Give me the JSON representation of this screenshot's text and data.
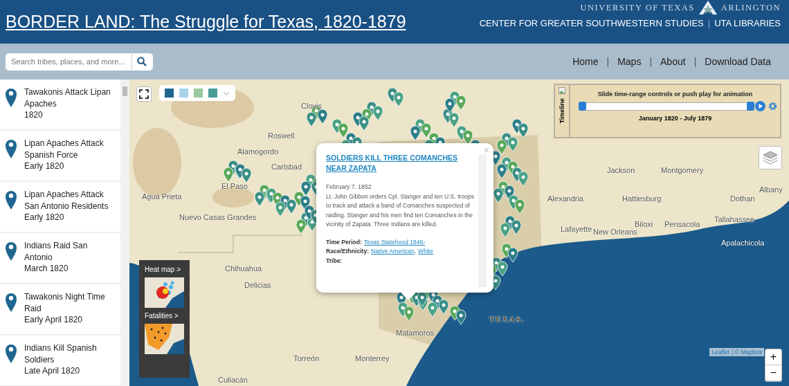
{
  "header": {
    "title": "BORDER LAND: The Struggle for Texas, 1820-1879",
    "university": "UNIVERSITY OF TEXAS",
    "university_2": "ARLINGTON",
    "links": [
      "CENTER FOR GREATER SOUTHWESTERN STUDIES",
      "UTA LIBRARIES"
    ],
    "separator": "|"
  },
  "search": {
    "placeholder": "Search tribes, places, and more..."
  },
  "nav": {
    "links": [
      "Home",
      "Maps",
      "About",
      "Download Data"
    ],
    "separator": "|"
  },
  "sidebar": {
    "items": [
      {
        "title": "Tawakonis Attack Lipan Apaches",
        "date": "1820"
      },
      {
        "title": "Lipan Apaches Attack Spanish Force",
        "date": "Early 1820"
      },
      {
        "title": "Lipan Apaches Attack San Antonio Residents",
        "date": "Early 1820"
      },
      {
        "title": "Indians Raid San Antonio",
        "date": "March 1820"
      },
      {
        "title": "Tawakonis Night Time Raid",
        "date": "Early April 1820"
      },
      {
        "title": "Indians Kill Spanish Soldiers",
        "date": "Late April 1820"
      }
    ]
  },
  "map": {
    "place_labels": [
      {
        "text": "Clovis",
        "kind": "city"
      },
      {
        "text": "Roswell",
        "kind": "city"
      },
      {
        "text": "Alamogordo",
        "kind": "city"
      },
      {
        "text": "Carlsbad",
        "kind": "city"
      },
      {
        "text": "Jackson",
        "kind": "city"
      },
      {
        "text": "Montgomery",
        "kind": "city"
      },
      {
        "text": "El Paso",
        "kind": "city"
      },
      {
        "text": "Albany",
        "kind": "city"
      },
      {
        "text": "Agua Prieta",
        "kind": "city"
      },
      {
        "text": "Alexandria",
        "kind": "city"
      },
      {
        "text": "Hattiesburg",
        "kind": "city"
      },
      {
        "text": "Dothan",
        "kind": "city"
      },
      {
        "text": "Nuevo Casas Grandes",
        "kind": "city"
      },
      {
        "text": "Tallahassee",
        "kind": "city"
      },
      {
        "text": "Biloxi",
        "kind": "city"
      },
      {
        "text": "Pensacola",
        "kind": "city"
      },
      {
        "text": "Lafayette",
        "kind": "city"
      },
      {
        "text": "New Orleans",
        "kind": "city"
      },
      {
        "text": "Apalachicola",
        "kind": "offshore"
      },
      {
        "text": "Chihuahua",
        "kind": "city"
      },
      {
        "text": "Delicias",
        "kind": "city"
      },
      {
        "text": "TEXAS.",
        "kind": "region"
      },
      {
        "text": "Matamoros",
        "kind": "city"
      },
      {
        "text": "Torreón",
        "kind": "city"
      },
      {
        "text": "Monterrey",
        "kind": "city"
      },
      {
        "text": "Culiacán",
        "kind": "city"
      }
    ],
    "style_swatches": [
      {
        "color": "#1f6690"
      },
      {
        "color": "#a8d2ea"
      },
      {
        "color": "#98c89e"
      },
      {
        "color": "#4a9c98"
      }
    ],
    "timeline": {
      "tab_label": "Timeline",
      "hint": "Slide time-range controls or push play for animation",
      "range": "January 1820 - July 1879",
      "level": 1
    },
    "popup": {
      "title": "SOLDIERS KILL THREE COMANCHES NEAR ZAPATA",
      "date": "February 7, 1852",
      "body": "Lt. John Gibbon orders Cpl. Stanger and ten U.S. troops to track and attack a band of Comanches suspected of raiding. Stanger and his men find ten Comanches in the vicinity of Zapata. Three Indians are killed.",
      "fields": [
        {
          "label": "Time Period:",
          "links": [
            "Texas Statehood 1846-"
          ]
        },
        {
          "label": "Race/Ethnicity:",
          "links": [
            "Native American",
            "White"
          ]
        },
        {
          "label": "Tribe:"
        }
      ],
      "link_separator": ",",
      "close": "×"
    },
    "thumbnails": [
      {
        "label": "Heat map >",
        "kind": "heat"
      },
      {
        "label": "Fatalities >",
        "kind": "fatalities"
      }
    ],
    "attribution": {
      "links": [
        "Leaflet",
        "Mapbox"
      ],
      "separator": "| ©"
    },
    "zoom": [
      "+",
      "−"
    ]
  }
}
